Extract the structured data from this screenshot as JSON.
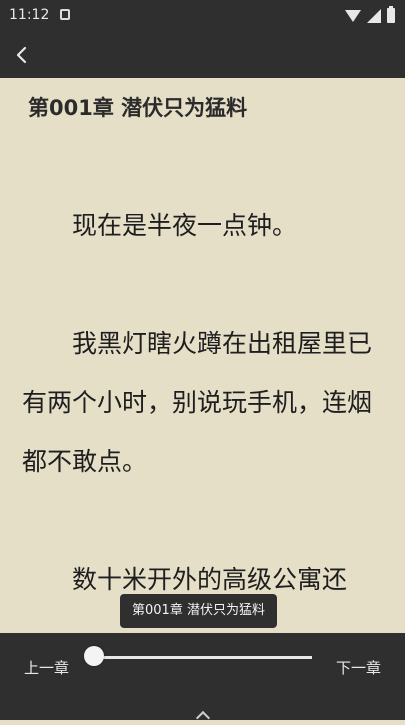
{
  "status_bar": {
    "time": "11:12"
  },
  "reader": {
    "chapter_title": "第001章 潜伏只为猛料",
    "paragraphs": [
      "现在是半夜一点钟。",
      "我黑灯瞎火蹲在出租屋里已有两个小时，别说玩手机，连烟都不敢点。",
      "数十米开外的高级公寓还"
    ]
  },
  "progress": {
    "tooltip": "第001章 潜伏只为猛料",
    "prev_label": "上一章",
    "next_label": "下一章",
    "position": 0
  },
  "colors": {
    "page_bg": "#e6dfc8",
    "bars": "#2f2f2f",
    "text": "#1e1e1e"
  }
}
